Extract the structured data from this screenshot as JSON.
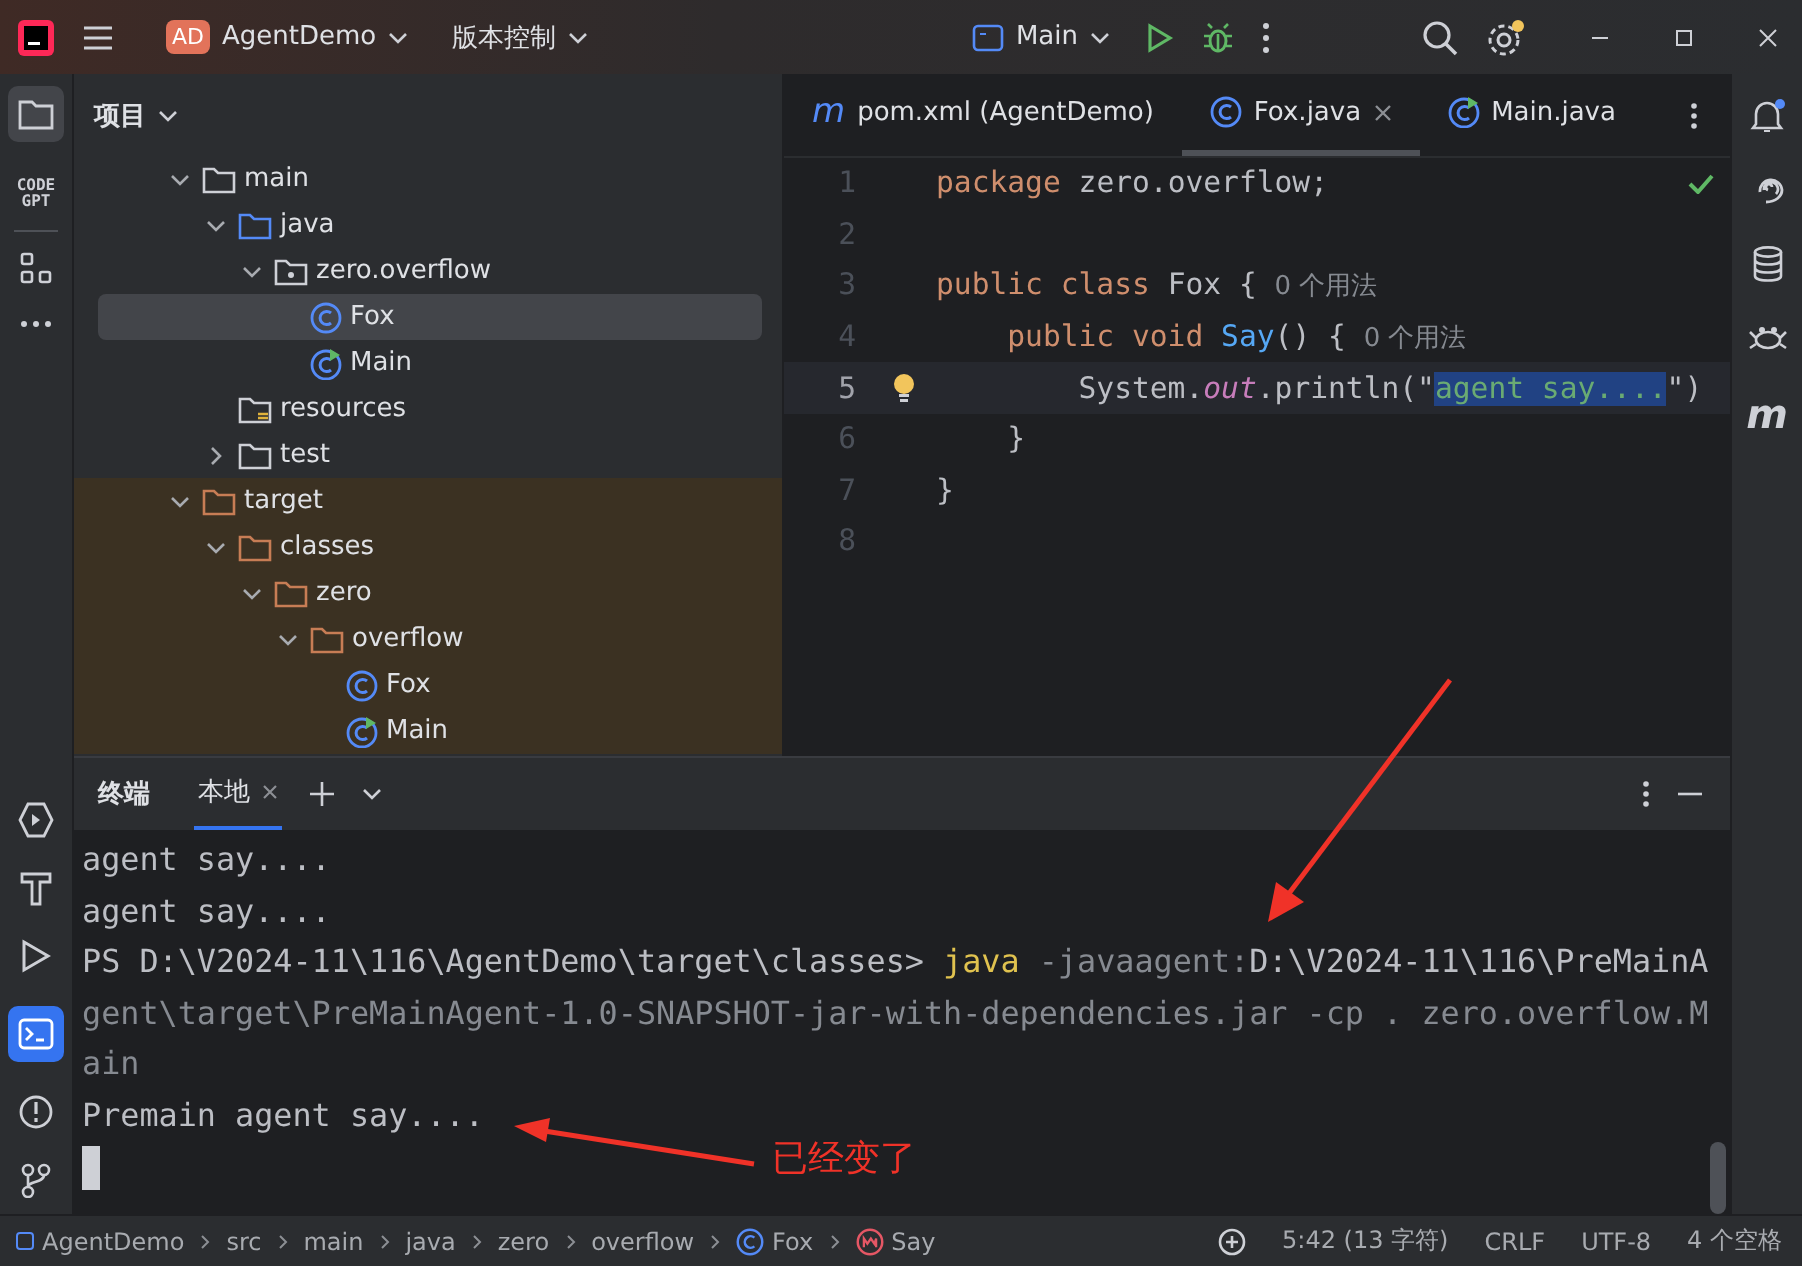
{
  "title_bar": {
    "project_badge": "AD",
    "project": "AgentDemo",
    "vcs": "版本控制",
    "run_config": "Main"
  },
  "left_strip": {
    "code_gpt": "CODE GPT"
  },
  "project_panel": {
    "title": "项目",
    "tree": [
      {
        "label": "main",
        "kind": "folder",
        "expanded": true,
        "selected": false,
        "excluded": false,
        "children": [
          {
            "label": "java",
            "kind": "source-folder",
            "expanded": true,
            "selected": false,
            "excluded": false,
            "children": [
              {
                "label": "zero.overflow",
                "kind": "package",
                "expanded": true,
                "selected": false,
                "excluded": false,
                "children": [
                  {
                    "label": "Fox",
                    "kind": "class",
                    "selected": true,
                    "excluded": false
                  },
                  {
                    "label": "Main",
                    "kind": "main-class",
                    "selected": false,
                    "excluded": false
                  }
                ]
              }
            ]
          },
          {
            "label": "resources",
            "kind": "resources-folder",
            "selected": false,
            "excluded": false
          },
          {
            "label": "test",
            "kind": "folder",
            "expanded": false,
            "selected": false,
            "excluded": false
          }
        ]
      },
      {
        "label": "target",
        "kind": "folder",
        "expanded": true,
        "selected": false,
        "excluded": true,
        "children": [
          {
            "label": "classes",
            "kind": "folder",
            "expanded": true,
            "selected": false,
            "excluded": true,
            "children": [
              {
                "label": "zero",
                "kind": "folder",
                "expanded": true,
                "selected": false,
                "excluded": true,
                "children": [
                  {
                    "label": "overflow",
                    "kind": "folder",
                    "expanded": true,
                    "selected": false,
                    "excluded": true,
                    "children": [
                      {
                        "label": "Fox",
                        "kind": "class",
                        "selected": false,
                        "excluded": true
                      },
                      {
                        "label": "Main",
                        "kind": "main-class",
                        "selected": false,
                        "excluded": true
                      }
                    ]
                  }
                ]
              }
            ]
          }
        ]
      }
    ]
  },
  "editor": {
    "tabs": [
      {
        "label": "pom.xml (AgentDemo)",
        "kind": "maven",
        "glyph": "m",
        "selected": false,
        "closable": false
      },
      {
        "label": "Fox.java",
        "kind": "class",
        "selected": true,
        "closable": true
      },
      {
        "label": "Main.java",
        "kind": "main-class",
        "selected": false,
        "closable": false
      }
    ],
    "lines": [
      {
        "number": "1",
        "current": false,
        "bulb": false,
        "tokens": [
          {
            "kind": "keyword",
            "text": "package "
          },
          {
            "kind": "plain",
            "text": "zero.overflow;"
          }
        ]
      },
      {
        "number": "2",
        "current": false,
        "bulb": false
      },
      {
        "number": "3",
        "current": false,
        "bulb": false,
        "tokens": [
          {
            "kind": "keyword",
            "text": "public class "
          },
          {
            "kind": "plain",
            "text": "Fox { "
          },
          {
            "kind": "hint",
            "text": "0 个用法"
          }
        ]
      },
      {
        "number": "4",
        "current": false,
        "bulb": false,
        "tokens": [
          {
            "kind": "keyword",
            "text": "    public void "
          },
          {
            "kind": "method",
            "text": "Say"
          },
          {
            "kind": "plain",
            "text": "() { "
          },
          {
            "kind": "hint",
            "text": "0 个用法"
          }
        ]
      },
      {
        "number": "5",
        "current": true,
        "bulb": true,
        "tokens": [
          {
            "kind": "plain",
            "text": "        System."
          },
          {
            "kind": "field",
            "text": "out"
          },
          {
            "kind": "plain",
            "text": ".println(\""
          },
          {
            "kind": "selected-string",
            "text": "agent say...."
          },
          {
            "kind": "plain",
            "text": "\")"
          }
        ]
      },
      {
        "number": "6",
        "current": false,
        "bulb": false,
        "tokens": [
          {
            "kind": "plain",
            "text": "    }"
          }
        ]
      },
      {
        "number": "7",
        "current": false,
        "bulb": false,
        "tokens": [
          {
            "kind": "plain",
            "text": "}"
          }
        ]
      },
      {
        "number": "8",
        "current": false,
        "bulb": false
      }
    ]
  },
  "right_strip": {
    "maven_glyph": "m"
  },
  "terminal": {
    "title": "终端",
    "tabs": [
      {
        "label": "本地",
        "selected": true
      }
    ],
    "lines": [
      [
        {
          "kind": "output",
          "text": "agent say...."
        }
      ],
      [
        {
          "kind": "output",
          "text": "agent say...."
        }
      ],
      [
        {
          "kind": "output",
          "text": "PS D:\\V2024-11\\116\\AgentDemo\\target\\classes> "
        },
        {
          "kind": "command",
          "text": "java"
        },
        {
          "kind": "arg",
          "text": " -javaagent:"
        },
        {
          "kind": "output",
          "text": "D:\\V2024-11\\116\\PreMainA"
        }
      ],
      [
        {
          "kind": "arg",
          "text": "gent\\target\\PreMainAgent-1.0-SNAPSHOT-jar-with-dependencies.jar -cp . zero.overflow.M"
        }
      ],
      [
        {
          "kind": "arg",
          "text": "ain"
        }
      ],
      [
        {
          "kind": "output",
          "text": "Premain agent say...."
        }
      ]
    ]
  },
  "annotation": {
    "label": "已经变了"
  },
  "status_bar": {
    "breadcrumbs": [
      {
        "label": "AgentDemo",
        "kind": "module"
      },
      {
        "label": "src",
        "kind": "plain"
      },
      {
        "label": "main",
        "kind": "plain"
      },
      {
        "label": "java",
        "kind": "plain"
      },
      {
        "label": "zero",
        "kind": "plain"
      },
      {
        "label": "overflow",
        "kind": "plain"
      },
      {
        "label": "Fox",
        "kind": "class"
      },
      {
        "label": "Say",
        "kind": "method"
      }
    ],
    "position": "5:42 (13 字符)",
    "line_ending": "CRLF",
    "encoding": "UTF-8",
    "indent": "4 个空格"
  }
}
